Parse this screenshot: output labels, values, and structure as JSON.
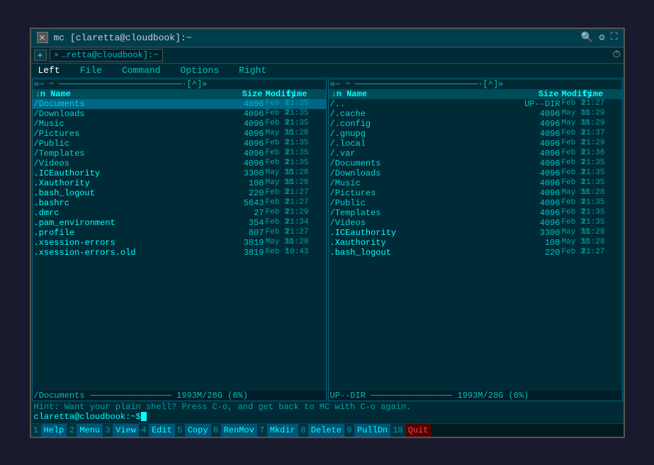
{
  "window": {
    "title": "mc [claretta@cloudbook]:~",
    "close_label": "✕"
  },
  "tabs": {
    "new_label": "+",
    "items": [
      {
        "label": "…retta@cloudbook]:~",
        "close": "✕"
      }
    ]
  },
  "menu": {
    "items": [
      "Left",
      "File",
      "Command",
      "Options",
      "Right"
    ]
  },
  "left_panel": {
    "header": "«─ ~ ────────────────────────·[^]»",
    "columns": [
      "↓n",
      "Name",
      "Size",
      "Modify time"
    ],
    "files": [
      {
        "name": "/Documents",
        "size": "4096",
        "date": "Feb  3",
        "time": "21:35",
        "selected": true
      },
      {
        "name": "/Downloads",
        "size": "4096",
        "date": "Feb  3",
        "time": "21:35"
      },
      {
        "name": "/Music",
        "size": "4096",
        "date": "Feb  3",
        "time": "21:35"
      },
      {
        "name": "/Pictures",
        "size": "4096",
        "date": "May 30",
        "time": "11:28"
      },
      {
        "name": "/Public",
        "size": "4096",
        "date": "Feb  3",
        "time": "21:35"
      },
      {
        "name": "/Templates",
        "size": "4096",
        "date": "Feb  3",
        "time": "21:35"
      },
      {
        "name": "/Videos",
        "size": "4096",
        "date": "Feb  3",
        "time": "21:35"
      },
      {
        "name": ".ICEauthority",
        "size": "3300",
        "date": "May 30",
        "time": "11:28"
      },
      {
        "name": ".Xauthority",
        "size": "108",
        "date": "May 30",
        "time": "11:28"
      },
      {
        "name": ".bash_logout",
        "size": "220",
        "date": "Feb  3",
        "time": "21:27"
      },
      {
        "name": ".bashrc",
        "size": "5643",
        "date": "Feb  3",
        "time": "21:27"
      },
      {
        "name": ".dmrc",
        "size": "27",
        "date": "Feb  3",
        "time": "21:29"
      },
      {
        "name": ".pam_environment",
        "size": "354",
        "date": "Feb  3",
        "time": "21:34"
      },
      {
        "name": ".profile",
        "size": "807",
        "date": "Feb  3",
        "time": "21:27"
      },
      {
        "name": ".xsession-errors",
        "size": "3819",
        "date": "May 30",
        "time": "11:28"
      },
      {
        "name": ".xsession-errors.old",
        "size": "3819",
        "date": "Feb  7",
        "time": "10:43"
      }
    ],
    "footer_path": "/Documents",
    "footer_status": "1993M/28G (6%)"
  },
  "right_panel": {
    "header": "«─ ~ ────────────────────────·[^]»",
    "columns": [
      "↓n",
      "Name",
      "Size",
      "Modify time"
    ],
    "files": [
      {
        "name": "/..",
        "size": "UP--DIR",
        "date": "Feb  3",
        "time": "21:27"
      },
      {
        "name": "/.cache",
        "size": "4096",
        "date": "May 30",
        "time": "11:29"
      },
      {
        "name": "/.config",
        "size": "4096",
        "date": "May 30",
        "time": "11:29"
      },
      {
        "name": "/.gnupg",
        "size": "4096",
        "date": "Feb  3",
        "time": "21:37"
      },
      {
        "name": "/.local",
        "size": "4096",
        "date": "Feb  3",
        "time": "21:29"
      },
      {
        "name": "/.var",
        "size": "4096",
        "date": "Feb  3",
        "time": "21:36"
      },
      {
        "name": "/Documents",
        "size": "4096",
        "date": "Feb  3",
        "time": "21:35"
      },
      {
        "name": "/Downloads",
        "size": "4096",
        "date": "Feb  3",
        "time": "21:35"
      },
      {
        "name": "/Music",
        "size": "4096",
        "date": "Feb  3",
        "time": "21:35"
      },
      {
        "name": "/Pictures",
        "size": "4096",
        "date": "May 30",
        "time": "11:28"
      },
      {
        "name": "/Public",
        "size": "4096",
        "date": "Feb  3",
        "time": "21:35"
      },
      {
        "name": "/Templates",
        "size": "4096",
        "date": "Feb  3",
        "time": "21:35"
      },
      {
        "name": "/Videos",
        "size": "4096",
        "date": "Feb  3",
        "time": "21:35"
      },
      {
        "name": ".ICEauthority",
        "size": "3300",
        "date": "May 30",
        "time": "11:28"
      },
      {
        "name": ".Xauthority",
        "size": "108",
        "date": "May 30",
        "time": "11:28"
      },
      {
        "name": ".bash_logout",
        "size": "220",
        "date": "Feb  3",
        "time": "21:27"
      }
    ],
    "footer_path": "UP--DIR",
    "footer_status": "1993M/28G (6%)"
  },
  "hint": "Hint: Want your plain shell? Press C-o, and get back to MC with C-o again.",
  "prompt": "claretta@cloudbook:~$",
  "function_keys": [
    {
      "num": "1",
      "label": "Help"
    },
    {
      "num": "2",
      "label": "Menu"
    },
    {
      "num": "3",
      "label": "View"
    },
    {
      "num": "4",
      "label": "Edit"
    },
    {
      "num": "5",
      "label": "Copy"
    },
    {
      "num": "6",
      "label": "RenMov"
    },
    {
      "num": "7",
      "label": "Mkdir"
    },
    {
      "num": "8",
      "label": "Delete"
    },
    {
      "num": "9",
      "label": "PullDn"
    },
    {
      "num": "10",
      "label": "Quit"
    }
  ]
}
